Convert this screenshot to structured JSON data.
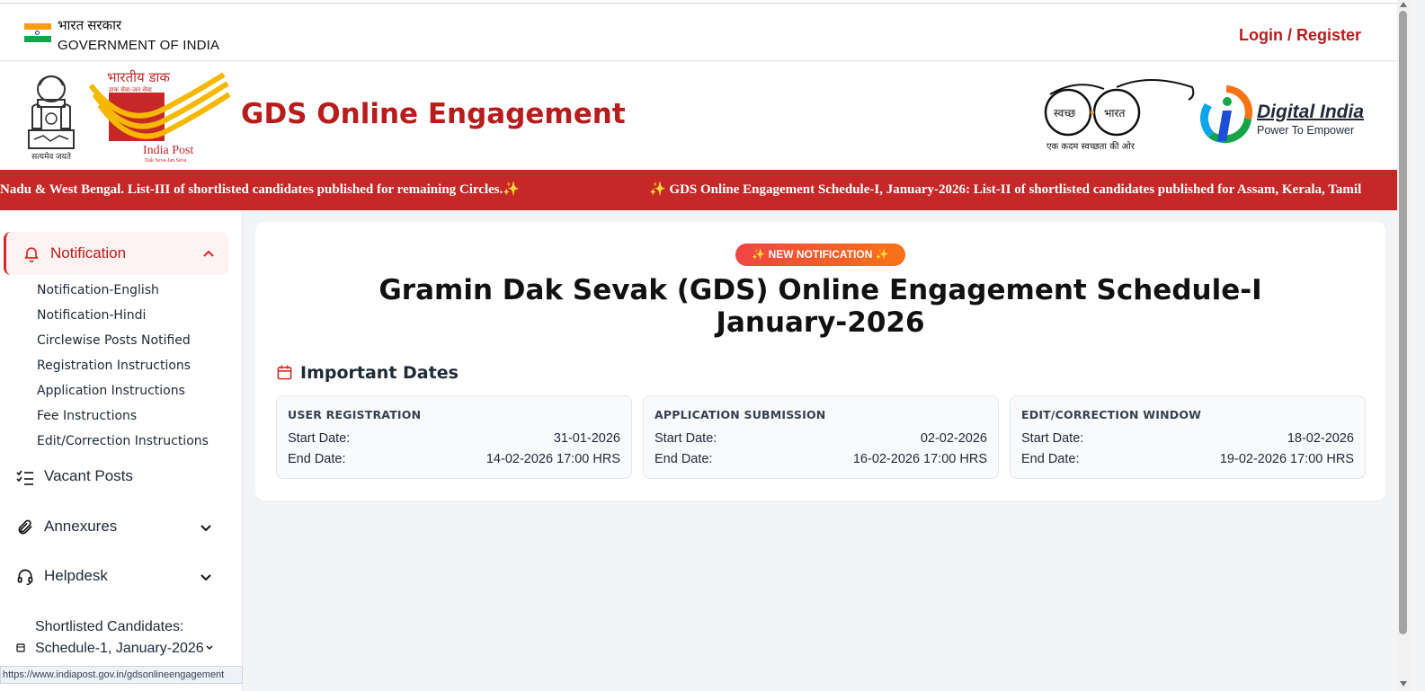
{
  "topbar": {
    "gov_hindi": "भारत सरकार",
    "gov_english": "GOVERNMENT OF INDIA",
    "login_label": "Login / Register"
  },
  "header": {
    "emblem_caption": "सत्यमेव जयते",
    "indiapost_hindi": "भारतीय डाक",
    "indiapost_tagline": "डाक सेवा-जन सेवा",
    "indiapost_name": "India Post",
    "indiapost_sub": "Dak Seva-Jan Seva",
    "site_title": "GDS Online Engagement",
    "swachh_left": "स्वच्छ",
    "swachh_right": "भारत",
    "swachh_caption": "एक कदम स्वच्छता की ओर",
    "digital_india_title": "Digital India",
    "digital_india_tagline": "Power To Empower"
  },
  "ticker": {
    "segment_1": "Nadu & West Bengal. List-III of shortlisted candidates published for remaining Circles.✨",
    "segment_2": "✨ GDS Online Engagement Schedule-I, January-2026: List-II of shortlisted candidates published for Assam, Kerala, Tamil"
  },
  "sidebar": {
    "notification_label": "Notification",
    "sub_items": [
      "Notification-English",
      "Notification-Hindi",
      "Circlewise Posts Notified",
      "Registration Instructions",
      "Application Instructions",
      "Fee Instructions",
      "Edit/Correction Instructions"
    ],
    "vacant_label": "Vacant Posts",
    "annexures_label": "Annexures",
    "helpdesk_label": "Helpdesk",
    "shortlisted_label": "Shortlisted Candidates: Schedule-1, January-2026"
  },
  "status_bar": {
    "url": "https://www.indiapost.gov.in/gdsonlineengagement"
  },
  "main": {
    "badge": "✨ NEW NOTIFICATION ✨",
    "title_line1": "Gramin Dak Sevak (GDS) Online Engagement Schedule-I",
    "title_line2": "January-2026",
    "dates_title": "Important Dates",
    "date_boxes": [
      {
        "title": "USER REGISTRATION",
        "start_label": "Start Date:",
        "start": "31-01-2026",
        "end_label": "End Date:",
        "end": "14-02-2026 17:00 HRS"
      },
      {
        "title": "APPLICATION SUBMISSION",
        "start_label": "Start Date:",
        "start": "02-02-2026",
        "end_label": "End Date:",
        "end": "16-02-2026 17:00 HRS"
      },
      {
        "title": "EDIT/CORRECTION WINDOW",
        "start_label": "Start Date:",
        "start": "18-02-2026",
        "end_label": "End Date:",
        "end": "19-02-2026 17:00 HRS"
      }
    ]
  },
  "colors": {
    "brand_red": "#b91c1c",
    "ticker_red": "#c62828",
    "badge_gradient_start": "#ef4444",
    "badge_gradient_end": "#f97316"
  }
}
